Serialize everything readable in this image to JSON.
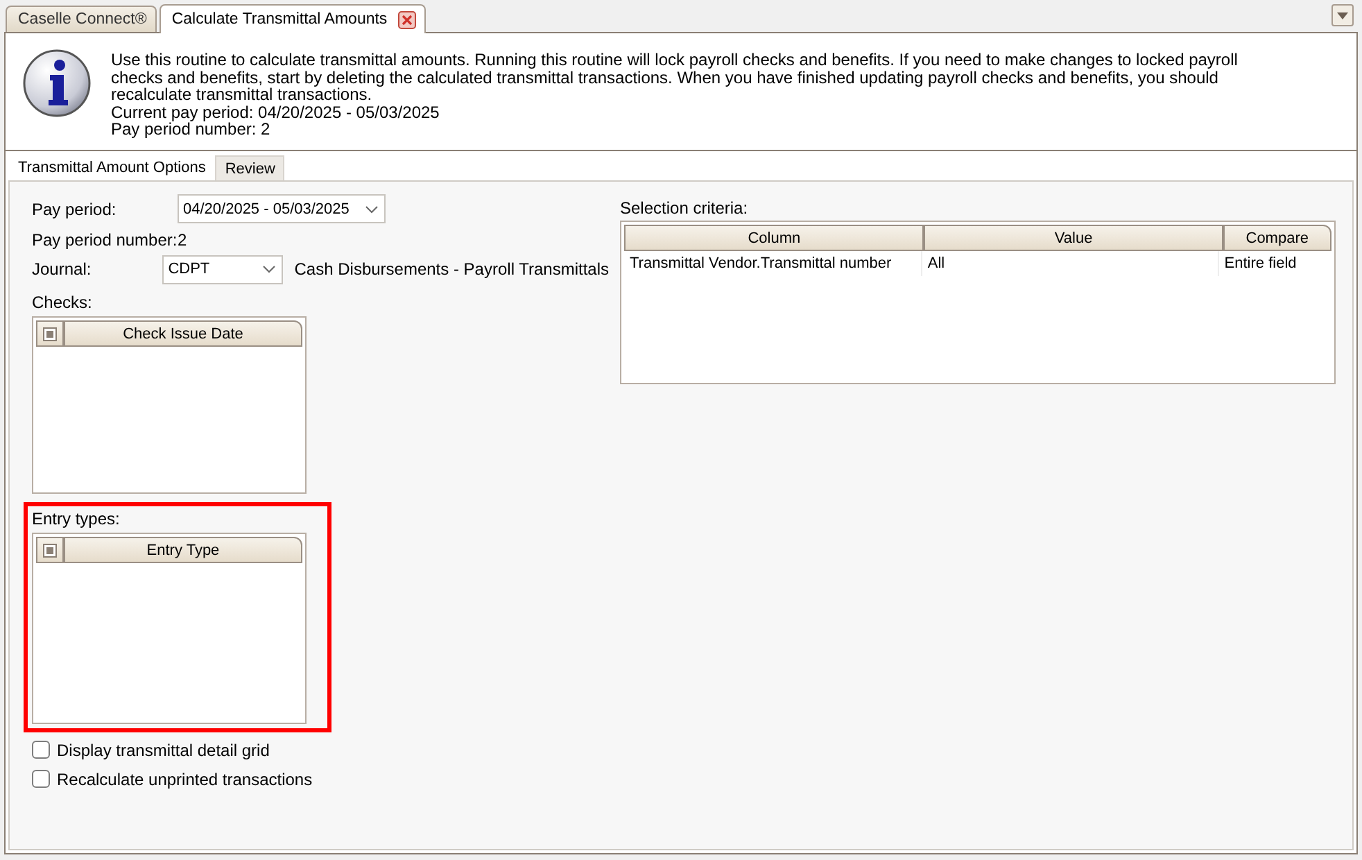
{
  "tabs": [
    {
      "label": "Caselle Connect®",
      "selected": false,
      "closable": false
    },
    {
      "label": "Calculate Transmittal Amounts",
      "selected": true,
      "closable": true
    }
  ],
  "info": {
    "description": "Use this routine to calculate transmittal amounts. Running this routine will lock payroll checks and benefits. If you need to make changes to locked payroll checks and benefits, start by deleting the calculated transmittal transactions. When you have finished updating payroll checks and benefits, you should recalculate transmittal transactions.",
    "lines": [
      "Current pay period: 04/20/2025 - 05/03/2025",
      "Pay period number: 2"
    ]
  },
  "subtabs": [
    {
      "label": "Transmittal Amount Options",
      "selected": true
    },
    {
      "label": "Review",
      "selected": false
    }
  ],
  "form": {
    "pay_period": {
      "label": "Pay period:",
      "value": "04/20/2025 - 05/03/2025"
    },
    "pay_period_number": {
      "label": "Pay period number:",
      "value": "2"
    },
    "journal": {
      "label": "Journal:",
      "value": "CDPT",
      "description": "Cash Disbursements - Payroll Transmittals"
    },
    "checks": {
      "label": "Checks:",
      "column": "Check Issue Date",
      "highlighted": false
    },
    "entry_types": {
      "label": "Entry types:",
      "column": "Entry Type",
      "highlighted": true
    },
    "options": [
      {
        "label": "Display transmittal detail grid",
        "checked": false
      },
      {
        "label": "Recalculate unprinted transactions",
        "checked": false
      }
    ]
  },
  "selection_criteria": {
    "label": "Selection criteria:",
    "columns": [
      "Column",
      "Value",
      "Compare"
    ],
    "rows": [
      [
        "Transmittal Vendor.Transmittal number",
        "All",
        "Entire field"
      ]
    ]
  }
}
